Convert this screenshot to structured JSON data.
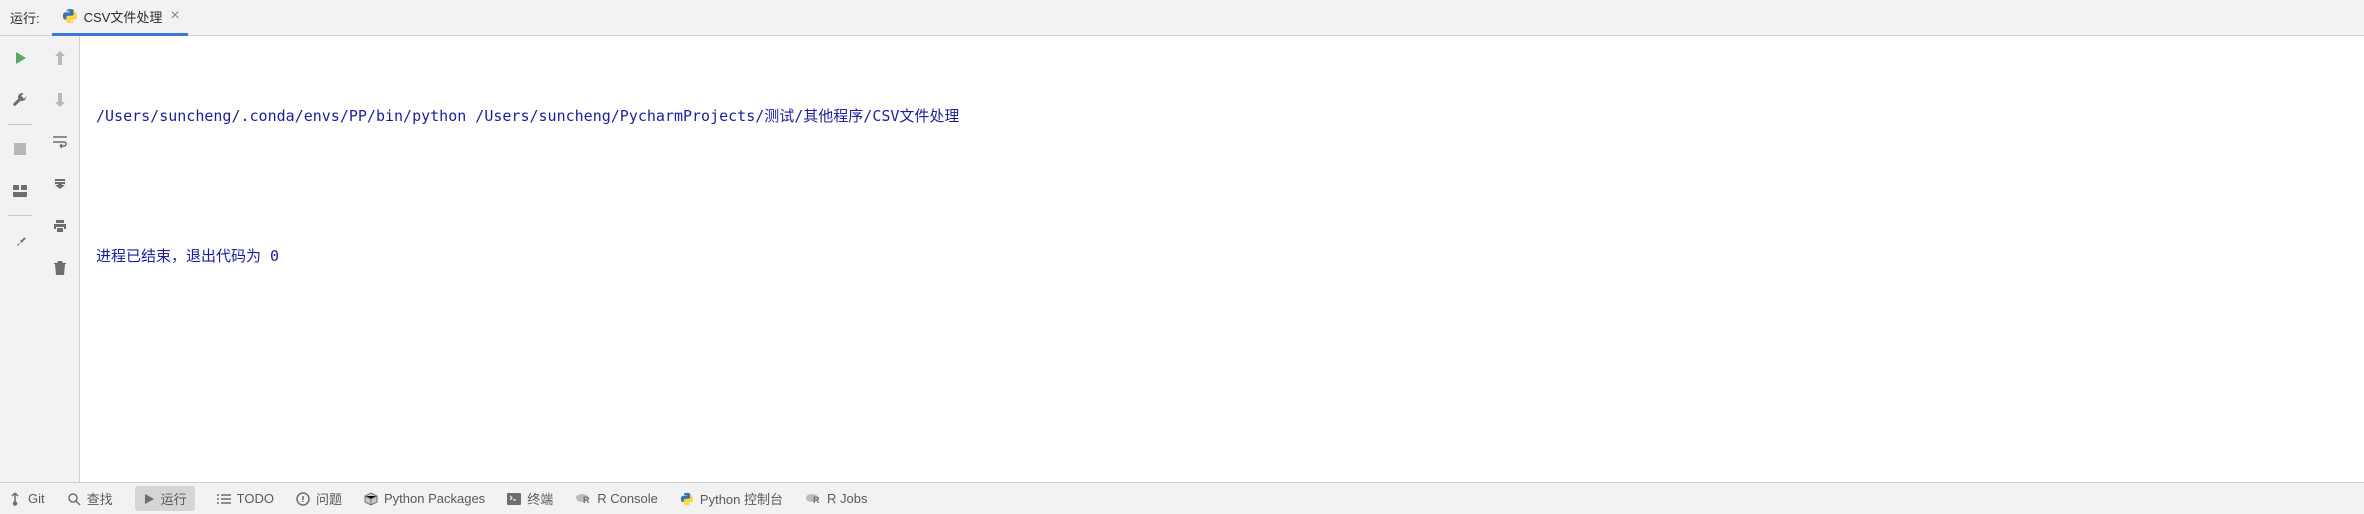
{
  "header": {
    "label": "运行:",
    "tab": {
      "label": "CSV文件处理"
    }
  },
  "console": {
    "line1": "/Users/suncheng/.conda/envs/PP/bin/python /Users/suncheng/PycharmProjects/测试/其他程序/CSV文件处理",
    "line2": "",
    "line3": "进程已结束，退出代码为 0"
  },
  "bottom": {
    "git": "Git",
    "find": "查找",
    "run": "运行",
    "todo": "TODO",
    "problems": "问题",
    "pypackages": "Python Packages",
    "terminal": "终端",
    "rconsole": "R Console",
    "pyconsole": "Python 控制台",
    "rjobs": "R Jobs"
  }
}
